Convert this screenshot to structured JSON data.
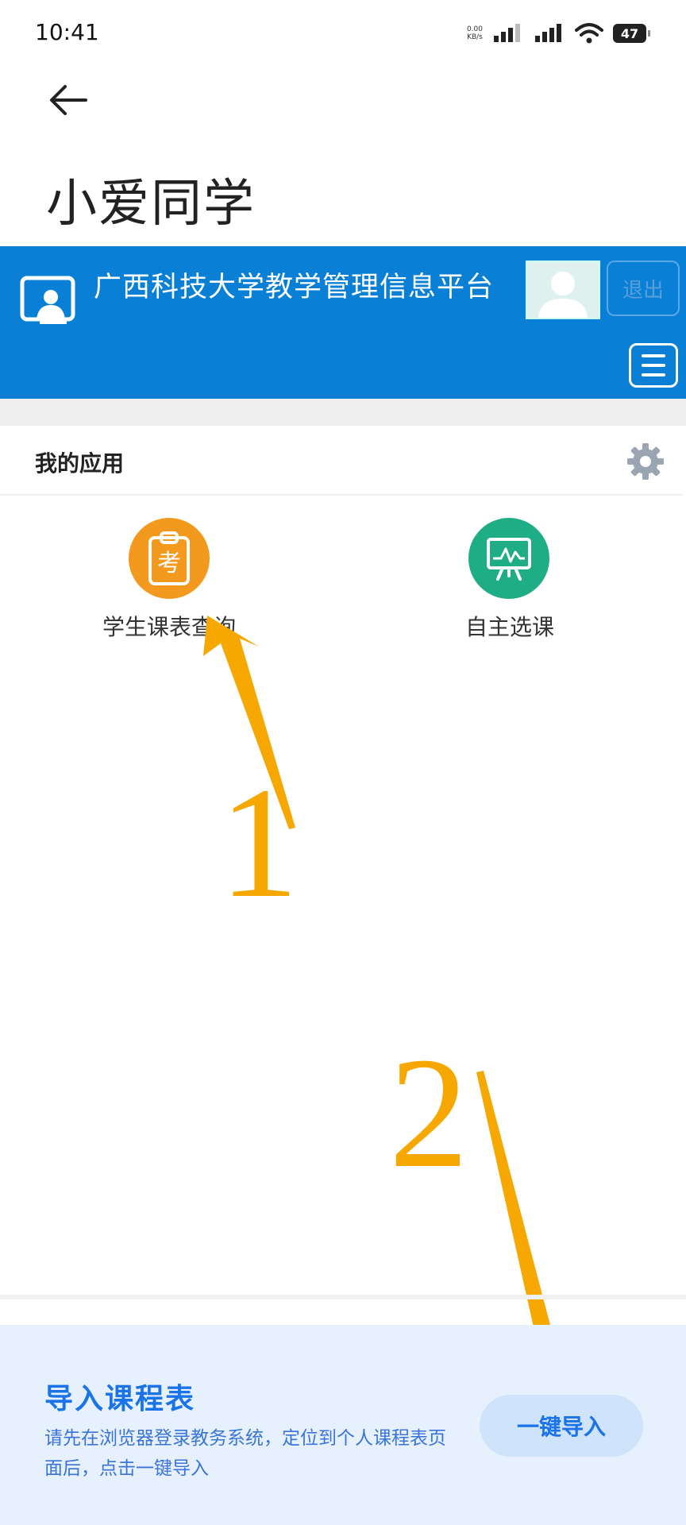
{
  "status_bar": {
    "time": "10:41",
    "net_speed_value": "0.00",
    "net_speed_unit": "KB/s",
    "battery": "47"
  },
  "page": {
    "title": "小爱同学"
  },
  "portal": {
    "name": "广西科技大学教学管理信息平台",
    "logout_label": "退出"
  },
  "apps_section": {
    "title": "我的应用",
    "apps": [
      {
        "label": "学生课表查询",
        "icon_char": "考",
        "icon": "exam-clipboard-icon",
        "color": "#f39a1e"
      },
      {
        "label": "自主选课",
        "icon": "presentation-chart-icon",
        "color": "#1fad86"
      }
    ]
  },
  "annotations": [
    "1",
    "2"
  ],
  "import_panel": {
    "title": "导入课程表",
    "description": "请先在浏览器登录教务系统，定位到个人课程表页面后，点击一键导入",
    "button_label": "一键导入"
  },
  "colors": {
    "header_blue": "#0a7fd6",
    "annotation_orange": "#f7a800",
    "accent_blue": "#1a73e8"
  }
}
